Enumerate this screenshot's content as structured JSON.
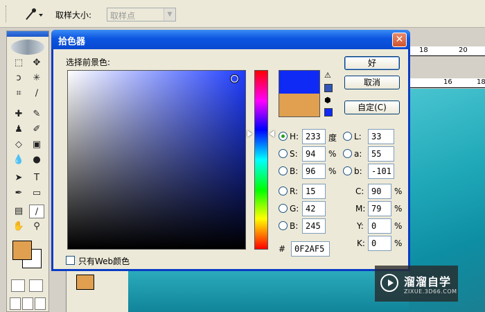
{
  "options_bar": {
    "tool_icon": "eyedropper-icon",
    "sample_size_label": "取样大小:",
    "sample_size_value": "取样点"
  },
  "rulers": {
    "top_ticks": [
      "18",
      "20"
    ],
    "second_ticks": [
      "16",
      "18"
    ]
  },
  "dialog": {
    "title": "拾色器",
    "close_glyph": "✕",
    "prompt": "选择前景色:",
    "buttons": {
      "ok": "好",
      "cancel": "取消",
      "custom": "自定(C)"
    },
    "colors": {
      "new": "#0F2AF5",
      "current": "#E0A050",
      "gamut_warning_swatch": "#3155B8",
      "web_safe_swatch": "#0F2AF5"
    },
    "hsb": {
      "h_label": "H:",
      "h_value": "233",
      "h_unit": "度",
      "s_label": "S:",
      "s_value": "94",
      "s_unit": "%",
      "b_label": "B:",
      "b_value": "96",
      "b_unit": "%"
    },
    "rgb": {
      "r_label": "R:",
      "r_value": "15",
      "g_label": "G:",
      "g_value": "42",
      "b_label": "B:",
      "b_value": "245"
    },
    "lab": {
      "l_label": "L:",
      "l_value": "33",
      "a_label": "a:",
      "a_value": "55",
      "b_label": "b:",
      "b_value": "-101"
    },
    "cmyk": {
      "c_label": "C:",
      "c_value": "90",
      "c_unit": "%",
      "m_label": "M:",
      "m_value": "79",
      "m_unit": "%",
      "y_label": "Y:",
      "y_value": "0",
      "y_unit": "%",
      "k_label": "K:",
      "k_value": "0",
      "k_unit": "%"
    },
    "hex": {
      "label": "#",
      "value": "0F2AF5"
    },
    "web_only_label": "只有Web颜色",
    "selected_mode": "H"
  },
  "watermark": {
    "name": "溜溜自学",
    "url": "ZIXUE.3D66.COM"
  }
}
